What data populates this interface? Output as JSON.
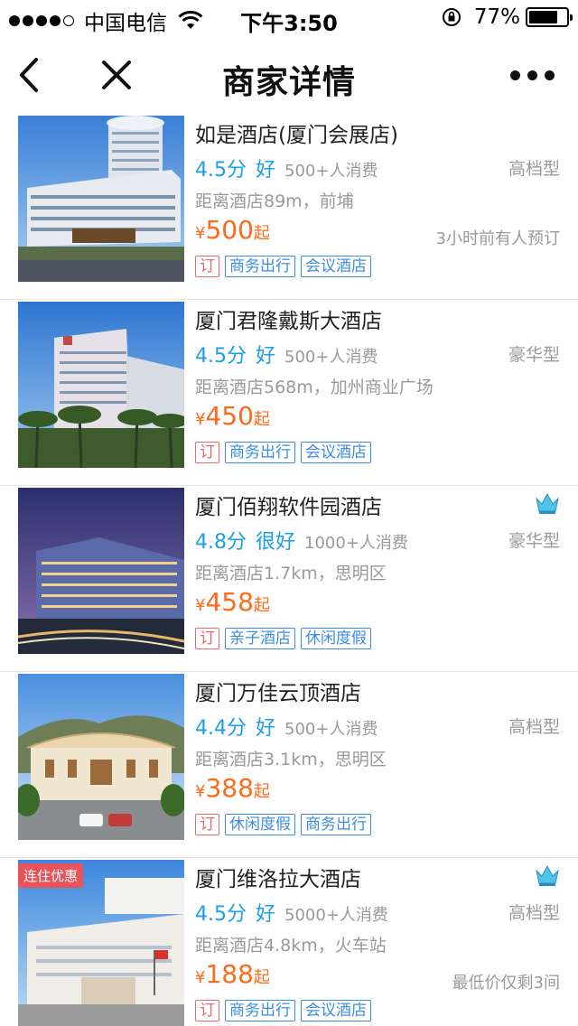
{
  "status_bar": {
    "carrier": "中国电信",
    "time": "下午3:50",
    "battery": "77%",
    "battery_level": 0.77
  },
  "nav": {
    "title": "商家详情"
  },
  "colors": {
    "score_blue": "#1a9ee8",
    "price_orange": "#ff6a1a",
    "tag_blue": "#3a8de0",
    "book_red": "#e86a6a",
    "promo_red": "#e8545b"
  },
  "hotels": [
    {
      "name": "如是酒店(厦门会展店)",
      "score": "4.5分",
      "rating_word": "好",
      "consume": "500+人消费",
      "grade": "高档型",
      "distance": "距离酒店89m，前埔",
      "yen": "¥",
      "price": "500",
      "qi": "起",
      "note": "3小时前有人预订",
      "tags": [
        "订",
        "商务出行",
        "会议酒店"
      ],
      "crown": false,
      "promo": ""
    },
    {
      "name": "厦门君隆戴斯大酒店",
      "score": "4.5分",
      "rating_word": "好",
      "consume": "500+人消费",
      "grade": "豪华型",
      "distance": "距离酒店568m，加州商业广场",
      "yen": "¥",
      "price": "450",
      "qi": "起",
      "note": "",
      "tags": [
        "订",
        "商务出行",
        "会议酒店"
      ],
      "crown": false,
      "promo": ""
    },
    {
      "name": "厦门佰翔软件园酒店",
      "score": "4.8分",
      "rating_word": "很好",
      "consume": "1000+人消费",
      "grade": "豪华型",
      "distance": "距离酒店1.7km，思明区",
      "yen": "¥",
      "price": "458",
      "qi": "起",
      "note": "",
      "tags": [
        "订",
        "亲子酒店",
        "休闲度假"
      ],
      "crown": true,
      "promo": ""
    },
    {
      "name": "厦门万佳云顶酒店",
      "score": "4.4分",
      "rating_word": "好",
      "consume": "500+人消费",
      "grade": "高档型",
      "distance": "距离酒店3.1km，思明区",
      "yen": "¥",
      "price": "388",
      "qi": "起",
      "note": "",
      "tags": [
        "订",
        "休闲度假",
        "商务出行"
      ],
      "crown": false,
      "promo": ""
    },
    {
      "name": "厦门维洛拉大酒店",
      "score": "4.5分",
      "rating_word": "好",
      "consume": "5000+人消费",
      "grade": "高档型",
      "distance": "距离酒店4.8km，火车站",
      "yen": "¥",
      "price": "188",
      "qi": "起",
      "note": "最低价仅剩3间",
      "tags": [
        "订",
        "商务出行",
        "会议酒店"
      ],
      "crown": true,
      "promo": "连住优惠"
    }
  ]
}
